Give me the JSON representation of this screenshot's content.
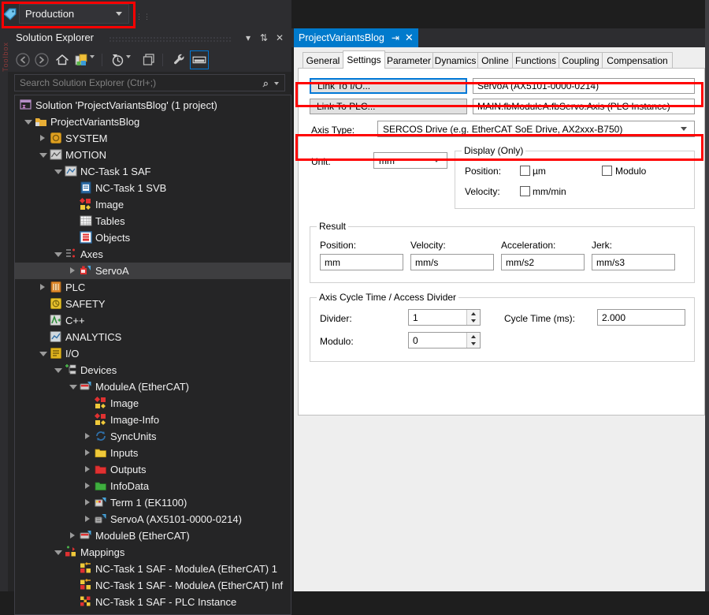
{
  "window": {
    "variant_selector": {
      "value": "Production",
      "icon": "variant-tag-icon"
    }
  },
  "solution_explorer": {
    "title": "Solution Explorer",
    "toolbar": [
      {
        "name": "back-icon",
        "glyph": "back"
      },
      {
        "name": "forward-icon",
        "glyph": "forward"
      },
      {
        "name": "home-icon",
        "glyph": "home"
      },
      {
        "name": "sync-with-active-document-icon",
        "glyph": "sync"
      },
      {
        "name": "pending-changes-filter-icon",
        "glyph": "clock"
      },
      {
        "name": "refresh-icon",
        "glyph": "refresh"
      },
      {
        "name": "properties-icon",
        "glyph": "wrench"
      },
      {
        "name": "preview-selected-items-icon",
        "glyph": "preview"
      }
    ],
    "search": {
      "placeholder": "Search Solution Explorer (Ctrl+;)"
    },
    "tree": [
      {
        "label": "Solution 'ProjectVariantsBlog' (1 project)",
        "depth": 0,
        "twisty": "none",
        "icon": "solution-icon",
        "selected": false
      },
      {
        "label": "ProjectVariantsBlog",
        "depth": 1,
        "twisty": "open",
        "icon": "project-icon",
        "selected": false
      },
      {
        "label": "SYSTEM",
        "depth": 2,
        "twisty": "closed",
        "icon": "system-icon",
        "selected": false
      },
      {
        "label": "MOTION",
        "depth": 2,
        "twisty": "open",
        "icon": "motion-icon",
        "selected": false
      },
      {
        "label": "NC-Task 1 SAF",
        "depth": 3,
        "twisty": "open",
        "icon": "nctask-icon",
        "selected": false
      },
      {
        "label": "NC-Task 1 SVB",
        "depth": 4,
        "twisty": "none",
        "icon": "svb-icon",
        "selected": false
      },
      {
        "label": "Image",
        "depth": 4,
        "twisty": "none",
        "icon": "image-icon",
        "selected": false
      },
      {
        "label": "Tables",
        "depth": 4,
        "twisty": "none",
        "icon": "tables-icon",
        "selected": false
      },
      {
        "label": "Objects",
        "depth": 4,
        "twisty": "none",
        "icon": "objects-icon",
        "selected": false
      },
      {
        "label": "Axes",
        "depth": 3,
        "twisty": "open",
        "icon": "axes-icon",
        "selected": false
      },
      {
        "label": "ServoA",
        "depth": 4,
        "twisty": "closed",
        "icon": "axis-icon",
        "selected": true
      },
      {
        "label": "PLC",
        "depth": 2,
        "twisty": "closed",
        "icon": "plc-icon",
        "selected": false
      },
      {
        "label": "SAFETY",
        "depth": 2,
        "twisty": "none",
        "icon": "safety-icon",
        "selected": false
      },
      {
        "label": "C++",
        "depth": 2,
        "twisty": "none",
        "icon": "cpp-icon",
        "selected": false
      },
      {
        "label": "ANALYTICS",
        "depth": 2,
        "twisty": "none",
        "icon": "analytics-icon",
        "selected": false
      },
      {
        "label": "I/O",
        "depth": 2,
        "twisty": "open",
        "icon": "io-icon",
        "selected": false
      },
      {
        "label": "Devices",
        "depth": 3,
        "twisty": "open",
        "icon": "devices-icon",
        "selected": false
      },
      {
        "label": "ModuleA (EtherCAT)",
        "depth": 4,
        "twisty": "open",
        "icon": "ethercat-device-icon",
        "selected": false
      },
      {
        "label": "Image",
        "depth": 5,
        "twisty": "none",
        "icon": "image-icon",
        "selected": false
      },
      {
        "label": "Image-Info",
        "depth": 5,
        "twisty": "none",
        "icon": "image-icon",
        "selected": false
      },
      {
        "label": "SyncUnits",
        "depth": 5,
        "twisty": "closed",
        "icon": "syncunits-icon",
        "selected": false
      },
      {
        "label": "Inputs",
        "depth": 5,
        "twisty": "closed",
        "icon": "inputs-icon",
        "selected": false
      },
      {
        "label": "Outputs",
        "depth": 5,
        "twisty": "closed",
        "icon": "outputs-icon",
        "selected": false
      },
      {
        "label": "InfoData",
        "depth": 5,
        "twisty": "closed",
        "icon": "infodata-icon",
        "selected": false
      },
      {
        "label": "Term 1 (EK1100)",
        "depth": 5,
        "twisty": "closed",
        "icon": "terminal-icon",
        "selected": false
      },
      {
        "label": "ServoA (AX5101-0000-0214)",
        "depth": 5,
        "twisty": "closed",
        "icon": "drive-icon",
        "selected": false
      },
      {
        "label": "ModuleB (EtherCAT)",
        "depth": 4,
        "twisty": "closed",
        "icon": "ethercat-device-icon",
        "selected": false
      },
      {
        "label": "Mappings",
        "depth": 3,
        "twisty": "open",
        "icon": "mappings-icon",
        "selected": false
      },
      {
        "label": "NC-Task 1 SAF - ModuleA (EtherCAT) 1",
        "depth": 4,
        "twisty": "none",
        "icon": "mapping-icon",
        "selected": false
      },
      {
        "label": "NC-Task 1 SAF - ModuleA (EtherCAT) Inf",
        "depth": 4,
        "twisty": "none",
        "icon": "mapping-icon",
        "selected": false
      },
      {
        "label": "NC-Task 1 SAF - PLC Instance",
        "depth": 4,
        "twisty": "none",
        "icon": "mapping-plc-icon",
        "selected": false
      }
    ]
  },
  "document": {
    "tab_title": "ProjectVariantsBlog",
    "pin_glyph": "⇥",
    "close_glyph": "✕",
    "property_tabs": [
      {
        "label": "General",
        "active": false
      },
      {
        "label": "Settings",
        "active": true
      },
      {
        "label": "Parameter",
        "active": false
      },
      {
        "label": "Dynamics",
        "active": false
      },
      {
        "label": "Online",
        "active": false
      },
      {
        "label": "Functions",
        "active": false
      },
      {
        "label": "Coupling",
        "active": false
      },
      {
        "label": "Compensation",
        "active": false
      }
    ],
    "settings": {
      "link_io_button": "Link To I/O...",
      "link_io_value": "ServoA (AX5101-0000-0214)",
      "link_plc_button": "Link To PLC...",
      "link_plc_value": "MAIN.fbModuleA.fbServo.Axis (PLC Instance)",
      "axis_type_label": "Axis Type:",
      "axis_type_value": "SERCOS Drive  (e.g. EtherCAT SoE Drive, AX2xxx-B750)",
      "unit_label": "Unit:",
      "unit_value": "mm",
      "display_group": {
        "caption": "Display (Only)",
        "position_label": "Position:",
        "position_checkbox_label": "µm",
        "position_checked": false,
        "modulo_checkbox_label": "Modulo",
        "modulo_checked": false,
        "velocity_label": "Velocity:",
        "velocity_checkbox_label": "mm/min",
        "velocity_checked": false
      },
      "result_group": {
        "caption": "Result",
        "fields": [
          {
            "label": "Position:",
            "value": "mm"
          },
          {
            "label": "Velocity:",
            "value": "mm/s"
          },
          {
            "label": "Acceleration:",
            "value": "mm/s2"
          },
          {
            "label": "Jerk:",
            "value": "mm/s3"
          }
        ]
      },
      "cycle_group": {
        "caption": "Axis Cycle Time / Access Divider",
        "divider_label": "Divider:",
        "divider_value": "1",
        "modulo_label": "Modulo:",
        "modulo_value": "0",
        "cycle_time_label": "Cycle Time (ms):",
        "cycle_time_value": "2.000"
      }
    }
  },
  "colors": {
    "highlight_red": "#ff0000",
    "accent_blue": "#007acc",
    "focus_blue": "#0078d7",
    "chrome_dark": "#2d2d30",
    "panel_dark": "#252526",
    "selection_gray": "#3e3e40"
  }
}
